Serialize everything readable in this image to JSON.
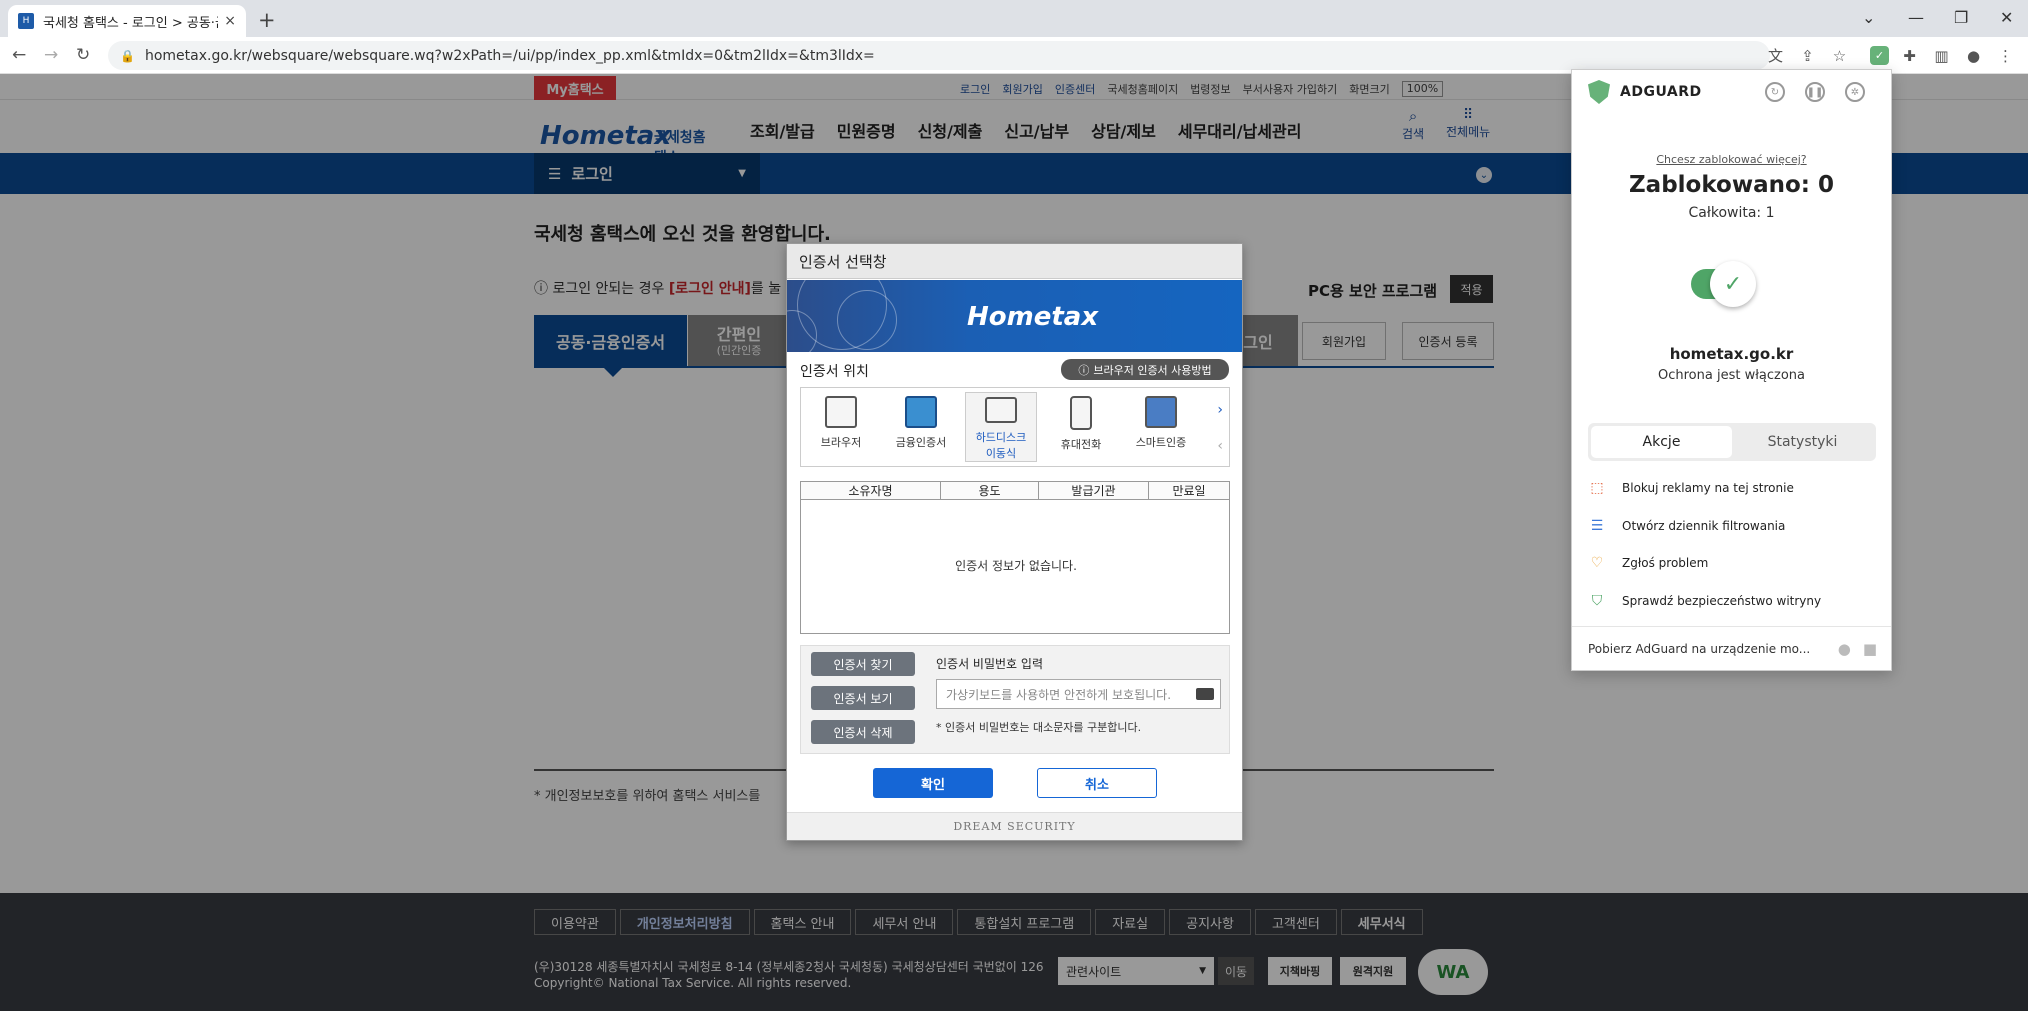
{
  "browser": {
    "tab_title": "국세청 홈택스 - 로그인 > 공동·금",
    "tab_close": "×",
    "new_tab": "+",
    "url": "hometax.go.kr/websquare/websquare.wq?w2xPath=/ui/pp/index_pp.xml&tmIdx=0&tm2lIdx=&tm3lIdx="
  },
  "site": {
    "my_hometax": "My홈택스",
    "top_links": [
      "로그인",
      "회원가입",
      "인증센터",
      "국세청홈페이지",
      "법령정보",
      "부서사용자 가입하기",
      "화면크기"
    ],
    "zoom": "100%",
    "logo_brand": "Hometax",
    "logo_kor": "국세청홈택스",
    "menu": [
      "조회/발급",
      "민원증명",
      "신청/제출",
      "신고/납부",
      "상담/제보",
      "세무대리/납세관리"
    ],
    "search_label": "검색",
    "allmenu_label": "전체메뉴",
    "breadcrumb": "로그인",
    "welcome": "국세청 홈택스에 오신 것을 환영합니다.",
    "login_note_prefix": "로그인 안되는 경우 ",
    "login_note_link": "[로그인 안내]",
    "login_note_suffix": "를 눌",
    "pc_security": "PC용 보안 프로그램",
    "apply": "적용",
    "tab_cert": "공동·금융인증서",
    "tab_simple": "간편인",
    "tab_simple_sub": "(민간인증",
    "tab_other": "그인",
    "join_btn": "회원가입",
    "cert_reg_btn": "인증서 등록",
    "privacy_note": "* 개인정보보호를 위하여 홈택스 서비스를 "
  },
  "footer": {
    "links": [
      "이용약관",
      "개인정보처리방침",
      "홈택스 안내",
      "세무서 안내",
      "통합설치 프로그램",
      "자료실",
      "공지사항",
      "고객센터",
      "세무서식"
    ],
    "address_line1": "(우)30128 세종특별자치시 국세청로 8-14 (정부세종2청사 국세청동) 국세청상담센터 국번없이 126",
    "address_line2": "Copyright© National Tax Service. All rights reserved.",
    "related_sites": "관련사이트",
    "go": "이동",
    "badge1": "지책바핑",
    "badge2": "원격지원",
    "wa": "WA"
  },
  "modal": {
    "title": "인증서 선택창",
    "banner_logo": "Hometax",
    "cert_location": "인증서 위치",
    "how_to": "브라우저 인증서 사용방법",
    "locations": [
      "브라우저",
      "금융인증서",
      "하드디스크 이동식",
      "휴대전화",
      "스마트인증"
    ],
    "columns": [
      "소유자명",
      "용도",
      "발급기관",
      "만료일"
    ],
    "empty": "인증서 정보가 없습니다.",
    "btn_find": "인증서 찾기",
    "btn_view": "인증서 보기",
    "btn_delete": "인증서 삭제",
    "pw_label": "인증서 비밀번호 입력",
    "pw_placeholder": "가상키보드를 사용하면 안전하게 보호됩니다.",
    "pw_note": "* 인증서 비밀번호는 대소문자를 구분합니다.",
    "ok": "확인",
    "cancel": "취소",
    "vendor": "DREAM SECURITY"
  },
  "adguard": {
    "name": "ADGUARD",
    "more": "Chcesz zablokować więcej?",
    "blocked": "Zablokowano: 0",
    "total": "Całkowita: 1",
    "domain": "hometax.go.kr",
    "protection": "Ochrona jest włączona",
    "tab_actions": "Akcje",
    "tab_stats": "Statystyki",
    "items": [
      "Blokuj reklamy na tej stronie",
      "Otwórz dziennik filtrowania",
      "Zgłoś problem",
      "Sprawdź bezpieczeństwo witryny"
    ],
    "footer": "Pobierz AdGuard na urządzenie mo..."
  },
  "colors": {
    "hometax_blue": "#0b4c97",
    "adguard_green": "#4fa567",
    "modal_ok": "#1566d6"
  }
}
